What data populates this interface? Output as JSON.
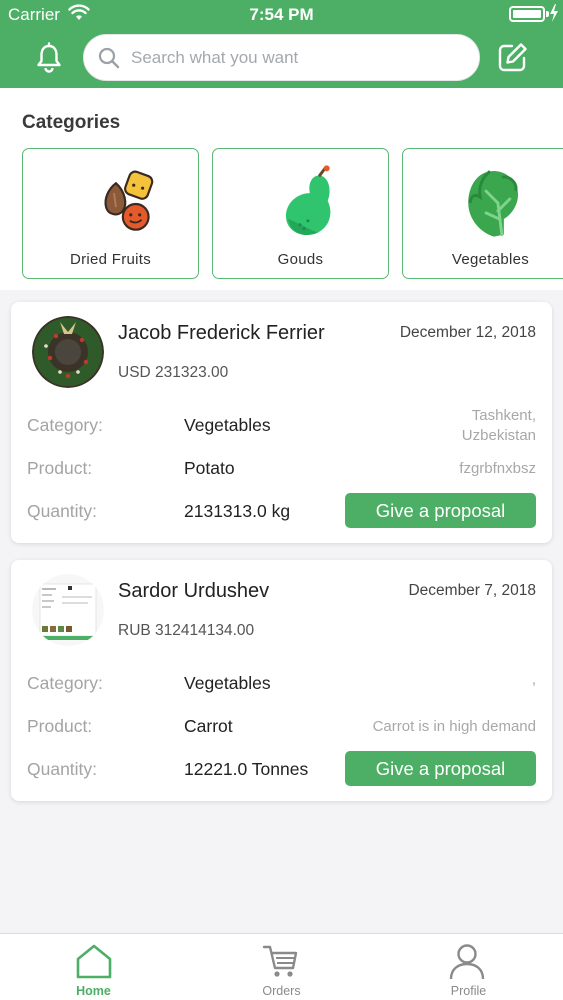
{
  "status_bar": {
    "carrier": "Carrier",
    "time": "7:54 PM"
  },
  "header": {
    "search_placeholder": "Search what you want"
  },
  "categories": {
    "title": "Categories",
    "items": [
      {
        "label": "Dried Fruits",
        "icon": "dried-fruits-icon"
      },
      {
        "label": "Gouds",
        "icon": "gourd-icon"
      },
      {
        "label": "Vegetables",
        "icon": "lettuce-icon"
      }
    ]
  },
  "labels": {
    "category": "Category:",
    "product": "Product:",
    "quantity": "Quantity:"
  },
  "proposals": [
    {
      "name": "Jacob Frederick Ferrier",
      "date": "December 12, 2018",
      "price": "USD 231323.00",
      "category": "Vegetables",
      "product": "Potato",
      "quantity": "2131313.0 kg",
      "location_line1": "Tashkent,",
      "location_line2": "Uzbekistan",
      "note": "fzgrbfnxbsz",
      "button": "Give a proposal"
    },
    {
      "name": "Sardor Urdushev",
      "date": "December 7, 2018",
      "price": "RUB 312414134.00",
      "category": "Vegetables",
      "product": "Carrot",
      "quantity": "12221.0 Tonnes",
      "location_line1": ",",
      "location_line2": "",
      "note": "Carrot is in high demand",
      "button": "Give a proposal"
    }
  ],
  "tabbar": {
    "items": [
      {
        "label": "Home",
        "icon": "home-icon",
        "active": true
      },
      {
        "label": "Orders",
        "icon": "cart-icon",
        "active": false
      },
      {
        "label": "Profile",
        "icon": "user-icon",
        "active": false
      }
    ]
  },
  "colors": {
    "primary": "#4caf65",
    "background": "#f4f4f6",
    "muted_text": "#a4a4a4"
  }
}
